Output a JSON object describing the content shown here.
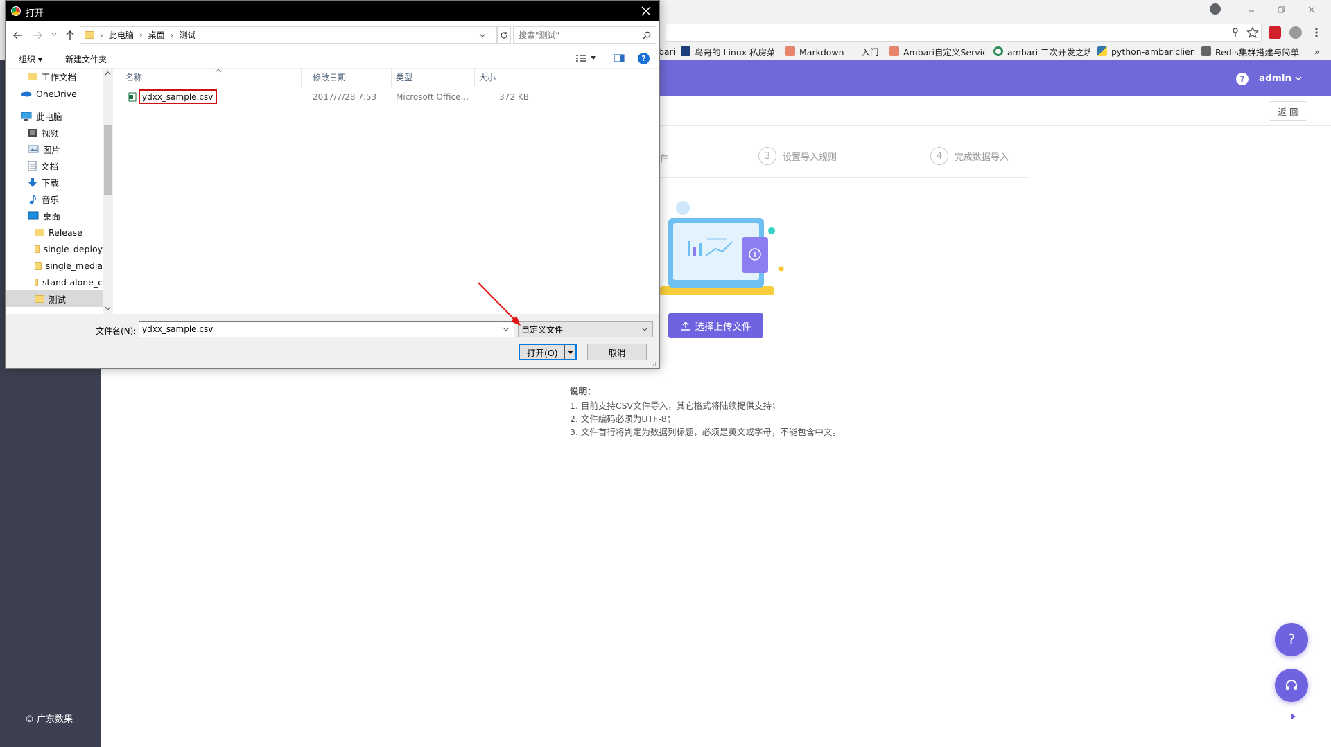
{
  "browser": {
    "bookmarks": [
      {
        "label": "bari",
        "icon": "page-icon"
      },
      {
        "label": "鸟哥的 Linux 私房菜",
        "icon": "bookmark-favicon"
      },
      {
        "label": "Markdown——入门",
        "icon": "jianshu-favicon"
      },
      {
        "label": "Ambari自定义Servic",
        "icon": "jianshu-favicon"
      },
      {
        "label": "ambari 二次开发之坑",
        "icon": "c-favicon"
      },
      {
        "label": "python-ambariclien",
        "icon": "python-favicon"
      },
      {
        "label": "Redis集群搭建与简单",
        "icon": "redis-favicon"
      }
    ],
    "more_label": "»"
  },
  "app": {
    "user": "admin",
    "back_label": "返 回",
    "steps": [
      {
        "num": "",
        "label": "件"
      },
      {
        "num": "3",
        "label": "设置导入规则"
      },
      {
        "num": "4",
        "label": "完成数据导入"
      }
    ],
    "upload_label": "选择上传文件",
    "notes_title": "说明：",
    "notes": [
      "1. 目前支持CSV文件导入，其它格式将陆续提供支持；",
      "2. 文件编码必须为UTF-8；",
      "3. 文件首行将判定为数据列标题，必须是英文或字母，不能包含中文。"
    ],
    "footer": "© 广东数果",
    "colors": {
      "brand": "#7069d9",
      "sidebar": "#3c4050"
    }
  },
  "dialog": {
    "title": "打开",
    "breadcrumb": [
      "此电脑",
      "桌面",
      "测试"
    ],
    "search_placeholder": "搜索\"测试\"",
    "organize_label": "组织 ▾",
    "new_folder_label": "新建文件夹",
    "tree": [
      {
        "label": "工作文档",
        "icon": "folder-icon",
        "indent": 1
      },
      {
        "label": "OneDrive",
        "icon": "onedrive-icon",
        "indent": 0
      },
      {
        "label": "此电脑",
        "icon": "computer-icon",
        "indent": 0
      },
      {
        "label": "视频",
        "icon": "video-icon",
        "indent": 1
      },
      {
        "label": "图片",
        "icon": "picture-icon",
        "indent": 1
      },
      {
        "label": "文档",
        "icon": "document-icon",
        "indent": 1
      },
      {
        "label": "下载",
        "icon": "download-icon",
        "indent": 1
      },
      {
        "label": "音乐",
        "icon": "music-icon",
        "indent": 1
      },
      {
        "label": "桌面",
        "icon": "desktop-icon",
        "indent": 1
      },
      {
        "label": "Release",
        "icon": "folder-icon",
        "indent": 2
      },
      {
        "label": "single_deploy",
        "icon": "folder-icon",
        "indent": 2
      },
      {
        "label": "single_media",
        "icon": "folder-icon",
        "indent": 2
      },
      {
        "label": "stand-alone_c",
        "icon": "folder-icon",
        "indent": 2
      },
      {
        "label": "测试",
        "icon": "folder-icon",
        "indent": 2,
        "selected": true
      }
    ],
    "columns": {
      "name": "名称",
      "date": "修改日期",
      "type": "类型",
      "size": "大小"
    },
    "files": [
      {
        "name": "ydxx_sample.csv",
        "date": "2017/7/28 7:53",
        "type": "Microsoft Office...",
        "size": "372 KB"
      }
    ],
    "filename_label": "文件名(N):",
    "filename_value": "ydxx_sample.csv",
    "filetype_value": "自定义文件",
    "open_label": "打开(O)",
    "cancel_label": "取消"
  }
}
